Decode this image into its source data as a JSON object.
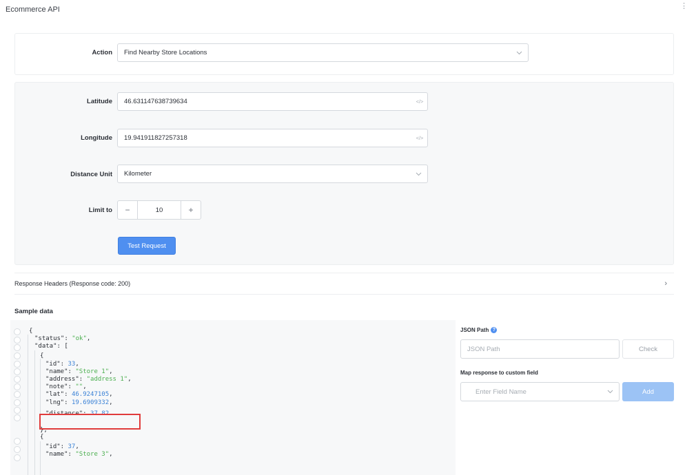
{
  "app": {
    "title": "Ecommerce API",
    "menu_glyph": "⋮"
  },
  "action": {
    "label": "Action",
    "value": "Find Nearby Store Locations"
  },
  "params": {
    "latitude": {
      "label": "Latitude",
      "value": "46.631147638739634",
      "code_icon": "</>"
    },
    "longitude": {
      "label": "Longitude",
      "value": "19.941911827257318",
      "code_icon": "</>"
    },
    "distance_unit": {
      "label": "Distance Unit",
      "value": "Kilometer"
    },
    "limit": {
      "label": "Limit to",
      "value": "10",
      "minus": "−",
      "plus": "+"
    },
    "test_button": "Test Request"
  },
  "response_headers": {
    "label": "Response Headers (Response code: 200)",
    "arrow": "›"
  },
  "sample": {
    "title": "Sample data",
    "lines": [
      {
        "tokens": [
          {
            "t": "k",
            "v": "{"
          }
        ]
      },
      {
        "tokens": [
          {
            "t": "k",
            "v": "\"status\": "
          },
          {
            "t": "s",
            "v": "\"ok\""
          },
          {
            "t": "k",
            "v": ","
          }
        ]
      },
      {
        "tokens": [
          {
            "t": "k",
            "v": "\"data\": ["
          }
        ]
      },
      {
        "tokens": [
          {
            "t": "k",
            "v": "{"
          }
        ]
      },
      {
        "tokens": [
          {
            "t": "k",
            "v": "\"id\": "
          },
          {
            "t": "n",
            "v": "33"
          },
          {
            "t": "k",
            "v": ","
          }
        ]
      },
      {
        "tokens": [
          {
            "t": "k",
            "v": "\"name\": "
          },
          {
            "t": "s",
            "v": "\"Store 1\""
          },
          {
            "t": "k",
            "v": ","
          }
        ]
      },
      {
        "tokens": [
          {
            "t": "k",
            "v": "\"address\": "
          },
          {
            "t": "s",
            "v": "\"address 1\""
          },
          {
            "t": "k",
            "v": ","
          }
        ]
      },
      {
        "tokens": [
          {
            "t": "k",
            "v": "\"note\": "
          },
          {
            "t": "s",
            "v": "\"\""
          },
          {
            "t": "k",
            "v": ","
          }
        ]
      },
      {
        "tokens": [
          {
            "t": "k",
            "v": "\"lat\": "
          },
          {
            "t": "n",
            "v": "46.9247105"
          },
          {
            "t": "k",
            "v": ","
          }
        ]
      },
      {
        "tokens": [
          {
            "t": "k",
            "v": "\"lng\": "
          },
          {
            "t": "n",
            "v": "19.6909332"
          },
          {
            "t": "k",
            "v": ","
          }
        ]
      },
      {
        "tokens": [
          {
            "t": "k",
            "v": "\"distance\": "
          },
          {
            "t": "n",
            "v": "37.82"
          }
        ]
      },
      {
        "tokens": [
          {
            "t": "k",
            "v": "},"
          }
        ]
      },
      {
        "tokens": [
          {
            "t": "k",
            "v": "{"
          }
        ]
      },
      {
        "tokens": [
          {
            "t": "k",
            "v": "\"id\": "
          },
          {
            "t": "n",
            "v": "37"
          },
          {
            "t": "k",
            "v": ","
          }
        ]
      },
      {
        "tokens": [
          {
            "t": "k",
            "v": "\"name\": "
          },
          {
            "t": "s",
            "v": "\"Store 3\""
          },
          {
            "t": "k",
            "v": ","
          }
        ]
      }
    ]
  },
  "json_path": {
    "label": "JSON Path",
    "help_glyph": "?",
    "placeholder": "JSON Path",
    "check_button": "Check"
  },
  "map_field": {
    "label": "Map response to custom field",
    "placeholder": "Enter Field Name",
    "add_button": "Add"
  },
  "colors": {
    "accent": "#4f8ff0",
    "accent_disabled": "#9cc3f5",
    "highlight": "#e03b3b",
    "string": "#4caf50",
    "number": "#3b82d6"
  }
}
